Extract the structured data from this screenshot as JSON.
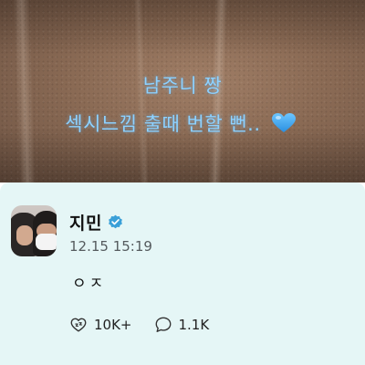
{
  "story": {
    "line1": "남주니 짱",
    "line2": "섹시느낌 출때 번할 뻔..",
    "heart_icon": "blue-heart-icon",
    "text_color": "#8fd2ff"
  },
  "post": {
    "author": "지민",
    "verified_icon": "verified-badge-icon",
    "badge_color": "#3aa0d8",
    "timestamp": "12.15 15:19",
    "text": "ㅇㅈ",
    "card_color": "#e5f6f6",
    "actions": [
      {
        "icon": "like-icon",
        "count": "10K+"
      },
      {
        "icon": "comment-icon",
        "count": "1.1K"
      }
    ]
  }
}
